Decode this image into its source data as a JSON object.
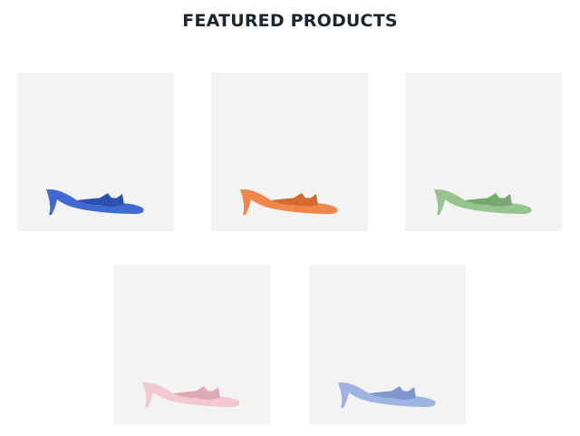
{
  "section": {
    "title": "FEATURED PRODUCTS"
  },
  "products": [
    {
      "image": "blue-kitten-heel-bow-mule",
      "color": "#3f6ad1",
      "shade": "#2d52ad"
    },
    {
      "image": "orange-kitten-heel-bow-mule",
      "color": "#f0874a",
      "shade": "#d46a2f"
    },
    {
      "image": "green-kitten-heel-bow-mule",
      "color": "#96c48e",
      "shade": "#77a86f"
    },
    {
      "image": "pink-kitten-heel-bow-mule",
      "color": "#f2c9d1",
      "shade": "#dfaab5"
    },
    {
      "image": "light-blue-kitten-heel-bow-mule",
      "color": "#9db4e3",
      "shade": "#7f97cc"
    }
  ]
}
